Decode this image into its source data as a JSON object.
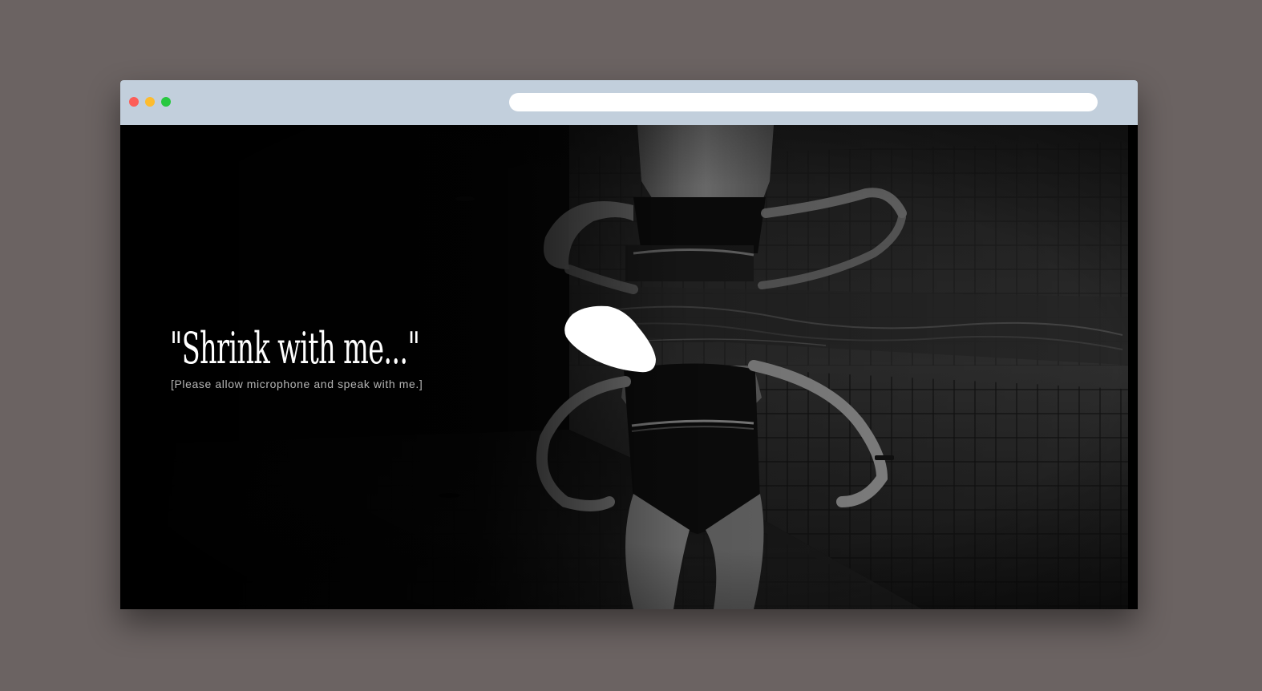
{
  "browser": {
    "url": ""
  },
  "page": {
    "headline": "\"Shrink with me...\"",
    "instruction": "[Please allow microphone and speak with me.]"
  },
  "background_photo": {
    "subject": "Black and white photo of a swimmer underwater in a tiled pool, her body reflected at the water surface"
  },
  "colors": {
    "desktop_background": "#6b6362",
    "titlebar": "#c2cfdc",
    "close_dot": "#fc5d57",
    "minimize_dot": "#fdbc2e",
    "maximize_dot": "#28c840",
    "page_background": "#000000",
    "blob": "#ffffff"
  }
}
